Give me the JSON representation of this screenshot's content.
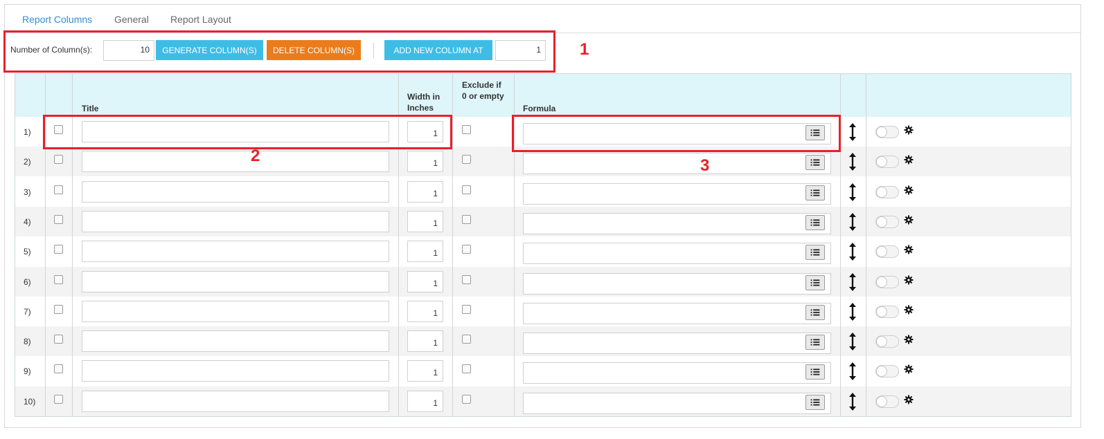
{
  "tabs": [
    {
      "label": "Report Columns",
      "active": true
    },
    {
      "label": "General",
      "active": false
    },
    {
      "label": "Report Layout",
      "active": false
    }
  ],
  "toolbar": {
    "num_columns_label": "Number of Column(s):",
    "num_columns_value": "10",
    "generate_label": "GENERATE COLUMN(S)",
    "delete_label": "DELETE COLUMN(S)",
    "add_new_label": "ADD NEW COLUMN AT",
    "add_new_value": "1"
  },
  "annotations": {
    "one": "1",
    "two": "2",
    "three": "3"
  },
  "table": {
    "headers": {
      "title": "Title",
      "width": "Width in Inches",
      "exclude": "Exclude if 0 or empty",
      "formula": "Formula"
    },
    "rows": [
      {
        "num": "1)",
        "width": "1"
      },
      {
        "num": "2)",
        "width": "1"
      },
      {
        "num": "3)",
        "width": "1"
      },
      {
        "num": "4)",
        "width": "1"
      },
      {
        "num": "5)",
        "width": "1"
      },
      {
        "num": "6)",
        "width": "1"
      },
      {
        "num": "7)",
        "width": "1"
      },
      {
        "num": "8)",
        "width": "1"
      },
      {
        "num": "9)",
        "width": "1"
      },
      {
        "num": "10)",
        "width": "1"
      }
    ]
  },
  "colors": {
    "accent_blue": "#3dbde6",
    "accent_orange": "#ea7c1c",
    "header_bg": "#def5f9",
    "annotation_red": "#e8202a",
    "active_tab": "#2e8fd6"
  },
  "icons": [
    "list-icon",
    "up-down-arrow-icon",
    "gear-icon"
  ]
}
